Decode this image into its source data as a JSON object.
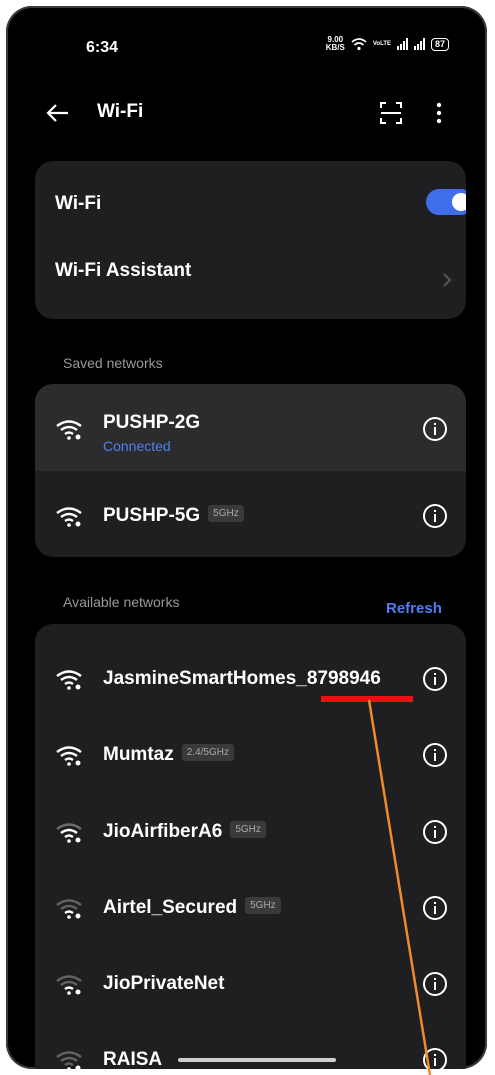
{
  "status": {
    "time": "6:34",
    "speed_value": "9.00",
    "speed_unit": "KB/S",
    "volte": "VoLTE",
    "battery": "87"
  },
  "header": {
    "title": "Wi-Fi"
  },
  "settings": {
    "wifi_label": "Wi-Fi",
    "wifi_enabled": true,
    "assistant_label": "Wi-Fi Assistant"
  },
  "saved": {
    "label": "Saved networks",
    "items": [
      {
        "ssid": "PUSHP-2G",
        "status": "Connected",
        "badge": ""
      },
      {
        "ssid": "PUSHP-5G",
        "badge": "5GHz"
      }
    ]
  },
  "available": {
    "label": "Available networks",
    "refresh": "Refresh",
    "items": [
      {
        "ssid": "JasmineSmartHomes_8798946",
        "badge": ""
      },
      {
        "ssid": "Mumtaz",
        "badge": "2.4/5GHz"
      },
      {
        "ssid": "JioAirfiberA6",
        "badge": "5GHz"
      },
      {
        "ssid": "Airtel_Secured",
        "badge": "5GHz"
      },
      {
        "ssid": "JioPrivateNet",
        "badge": ""
      },
      {
        "ssid": "RAISA",
        "badge": ""
      }
    ]
  },
  "colors": {
    "accent": "#4e7ff0",
    "card": "#1f1f21",
    "annotation_red": "#e21414",
    "annotation_orange": "#f08a2a"
  }
}
